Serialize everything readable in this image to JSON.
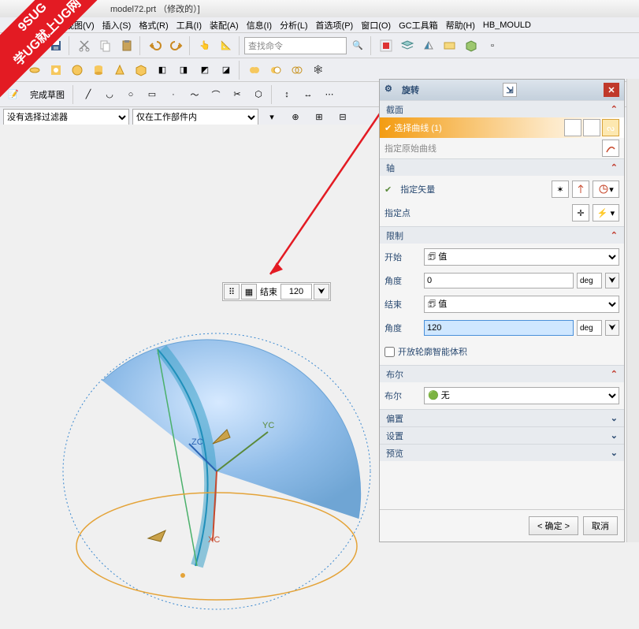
{
  "title": "model72.prt （修改的）]",
  "watermark_l1": "9SUG",
  "watermark_l2": "学UG就上UG网",
  "menu": [
    "视图(V)",
    "插入(S)",
    "格式(R)",
    "工具(I)",
    "装配(A)",
    "信息(I)",
    "分析(L)",
    "首选项(P)",
    "窗口(O)",
    "GC工具箱",
    "帮助(H)",
    "HB_MOULD"
  ],
  "search_placeholder": "查找命令",
  "sketch_button": "完成草图",
  "filter1": "没有选择过滤器",
  "filter2": "仅在工作部件内",
  "quickbar": {
    "label": "结束",
    "value": "120"
  },
  "axis_labels": {
    "x": "XC",
    "y": "YC",
    "z": "ZC"
  },
  "panel": {
    "title": "旋转",
    "sections": {
      "jiemian": "截面",
      "select_curve": "选择曲线 (1)",
      "orig_curve": "指定原始曲线",
      "zhou": "轴",
      "spec_vector": "指定矢量",
      "spec_point": "指定点",
      "xianzhi": "限制",
      "start": "开始",
      "value_label": "值",
      "angle": "角度",
      "end": "结束",
      "angle2": "角度",
      "start_val": "0",
      "end_val": "120",
      "unit": "deg",
      "open_profile": "开放轮廓智能体积",
      "buer": "布尔",
      "buer_val": "无",
      "pianzhi": "偏置",
      "shezhi": "设置",
      "yulan": "预览"
    },
    "ok": "< 确定 >",
    "cancel": "取消"
  }
}
